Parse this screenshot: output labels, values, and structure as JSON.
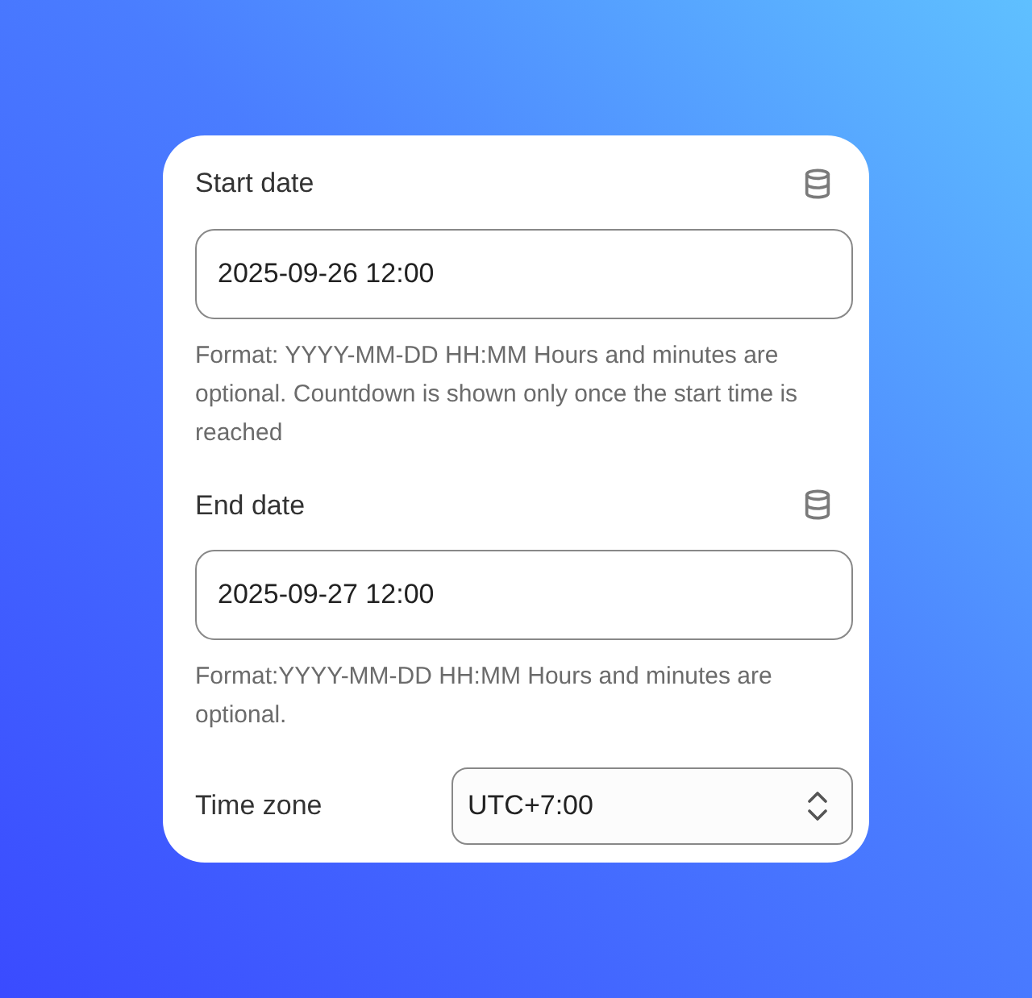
{
  "fields": [
    {
      "label": "Start date",
      "value": "2025-09-26 12:00",
      "help": "Format: YYYY-MM-DD HH:MM Hours and minutes are optional. Countdown is shown only once the start time is reached"
    },
    {
      "label": "End date",
      "value": "2025-09-27 12:00",
      "help": "Format:YYYY-MM-DD HH:MM Hours and minutes are optional."
    }
  ],
  "time_zone": {
    "label": "Time zone",
    "value": "UTC+7:00"
  }
}
